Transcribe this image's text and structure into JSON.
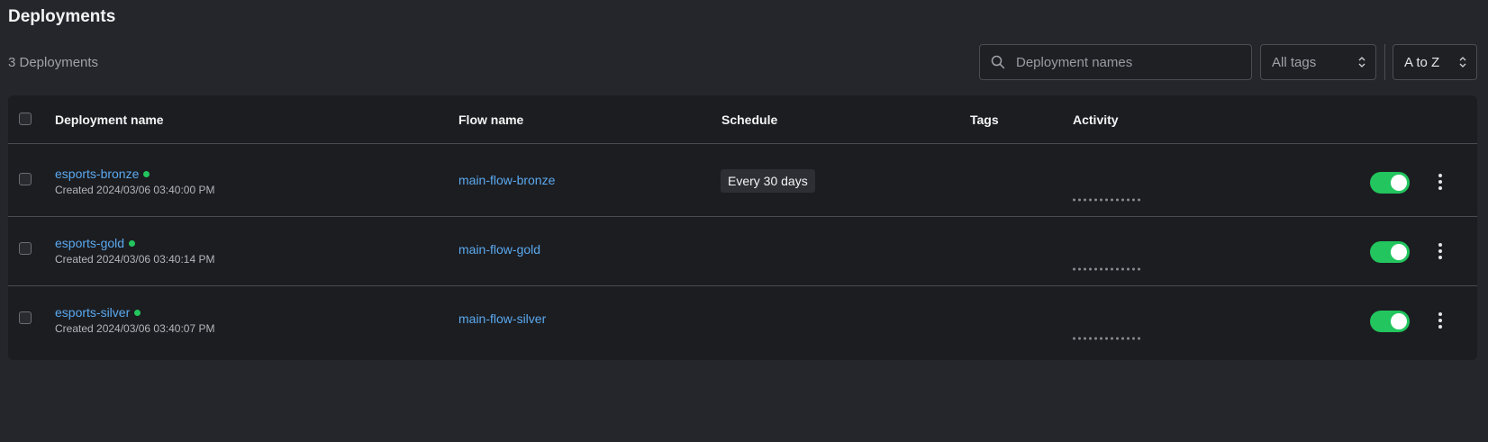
{
  "header": {
    "title": "Deployments",
    "count_label": "3 Deployments"
  },
  "filters": {
    "search_placeholder": "Deployment names",
    "tags_label": "All tags",
    "sort_label": "A to Z"
  },
  "table": {
    "columns": [
      "Deployment name",
      "Flow name",
      "Schedule",
      "Tags",
      "Activity"
    ],
    "rows": [
      {
        "name": "esports-bronze",
        "created": "Created 2024/03/06 03:40:00 PM",
        "flow": "main-flow-bronze",
        "schedule": "Every 30 days",
        "status_color": "#22c55e",
        "enabled": true
      },
      {
        "name": "esports-gold",
        "created": "Created 2024/03/06 03:40:14 PM",
        "flow": "main-flow-gold",
        "schedule": "",
        "status_color": "#22c55e",
        "enabled": true
      },
      {
        "name": "esports-silver",
        "created": "Created 2024/03/06 03:40:07 PM",
        "flow": "main-flow-silver",
        "schedule": "",
        "status_color": "#22c55e",
        "enabled": true
      }
    ]
  },
  "colors": {
    "background": "#25262b",
    "panel": "#1c1d21",
    "link": "#5aa9ef",
    "accent": "#22c55e"
  }
}
